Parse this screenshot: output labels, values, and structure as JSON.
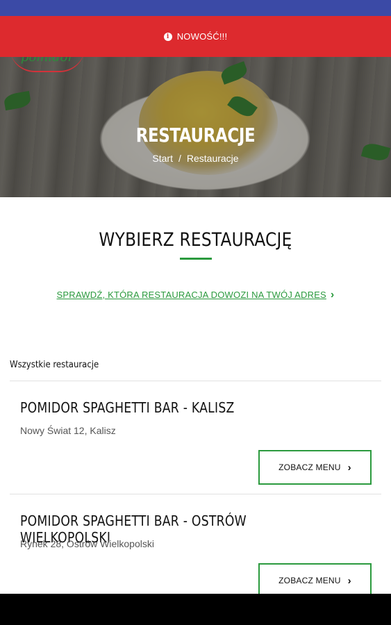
{
  "banner": {
    "icon": "info-icon",
    "label": "NOWOŚĆ!!!"
  },
  "hero": {
    "logo_text": "pomidor",
    "title": "RESTAURACJE",
    "breadcrumb": {
      "home": "Start",
      "separator": "/",
      "current": "Restauracje"
    }
  },
  "main": {
    "title": "WYBIERZ RESTAURACJĘ",
    "check_link": "SPRAWDŹ, KTÓRA RESTAURACJA DOWOZI NA TWÓJ ADRES",
    "all_label": "Wszystkie restauracje",
    "restaurants": [
      {
        "name": "POMIDOR SPAGHETTI BAR - KALISZ",
        "address": "Nowy Świat 12, Kalisz",
        "button": "ZOBACZ MENU"
      },
      {
        "name": "POMIDOR SPAGHETTI BAR - OSTRÓW WIELKOPOLSKI",
        "address": "Rynek 28, Ostrów Wielkopolski",
        "button": "ZOBACZ MENU"
      }
    ]
  },
  "colors": {
    "status_bar": "#3b4aa6",
    "banner": "#dd2a2e",
    "accent": "#2b9a3e"
  }
}
